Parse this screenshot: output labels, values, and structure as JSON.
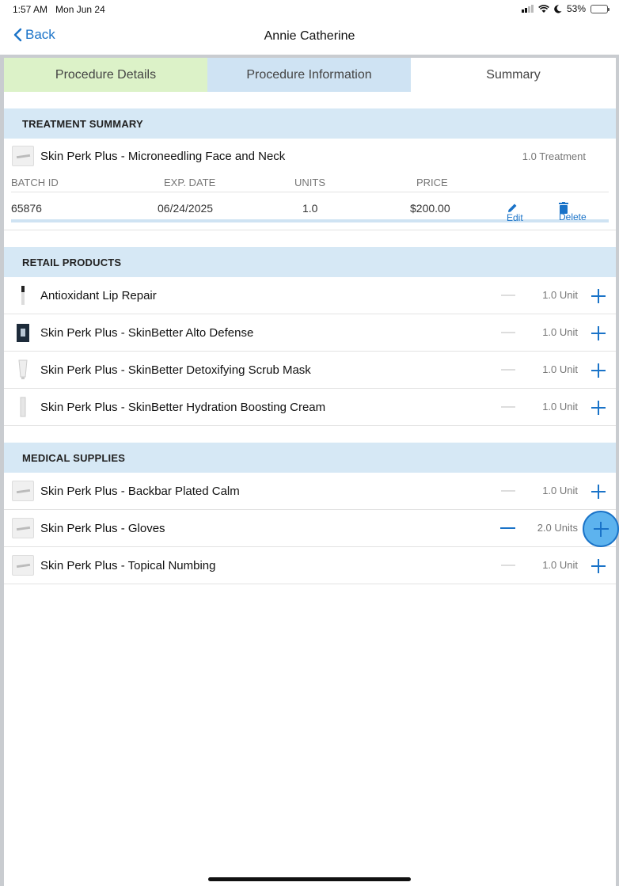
{
  "status": {
    "time": "1:57 AM",
    "date": "Mon Jun 24",
    "battery": "53%"
  },
  "nav": {
    "back_label": "Back",
    "title": "Annie Catherine"
  },
  "tabs": [
    {
      "label": "Procedure Details"
    },
    {
      "label": "Procedure Information"
    },
    {
      "label": "Summary"
    }
  ],
  "treatment": {
    "header": "TREATMENT SUMMARY",
    "name": "Skin Perk Plus - Microneedling Face and Neck",
    "quantity": "1.0 Treatment",
    "columns": {
      "batch": "BATCH ID",
      "exp": "EXP. DATE",
      "units": "UNITS",
      "price": "PRICE"
    },
    "row": {
      "batch": "65876",
      "exp": "06/24/2025",
      "units": "1.0",
      "price": "$200.00"
    },
    "edit_label": "Edit",
    "delete_label": "Delete"
  },
  "retail": {
    "header": "RETAIL PRODUCTS",
    "items": [
      {
        "name": "Antioxidant Lip Repair",
        "qty": "1.0 Unit"
      },
      {
        "name": "Skin Perk Plus - SkinBetter Alto Defense",
        "qty": "1.0 Unit"
      },
      {
        "name": "Skin Perk Plus - SkinBetter Detoxifying Scrub Mask",
        "qty": "1.0 Unit"
      },
      {
        "name": "Skin Perk Plus - SkinBetter Hydration Boosting Cream",
        "qty": "1.0 Unit"
      }
    ]
  },
  "medical": {
    "header": "MEDICAL SUPPLIES",
    "items": [
      {
        "name": "Skin Perk Plus - Backbar Plated Calm",
        "qty": "1.0 Unit"
      },
      {
        "name": "Skin Perk Plus - Gloves",
        "qty": "2.0 Units"
      },
      {
        "name": "Skin Perk Plus - Topical Numbing",
        "qty": "1.0 Unit"
      }
    ]
  },
  "colors": {
    "accent": "#1a73c8",
    "tab_details": "#dcf2c8",
    "tab_info": "#cfe3f3",
    "section": "#d6e8f5"
  }
}
